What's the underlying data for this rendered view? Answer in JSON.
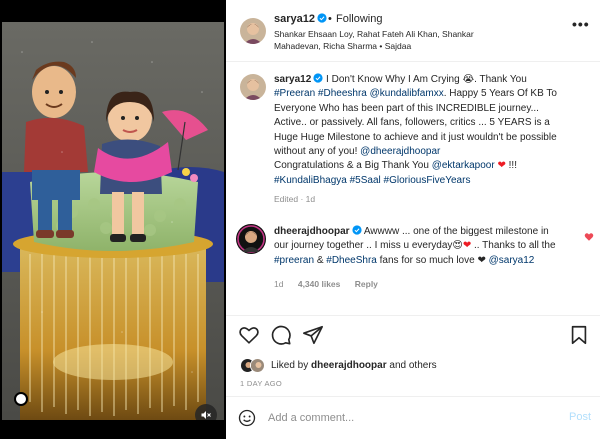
{
  "post": {
    "author": "sarya12",
    "follow_label": "Following",
    "separator": "•",
    "audio": "Shankar Ehsaan Loy, Rahat Fateh Ali Khan, Shankar Mahadevan, Richa Sharma • Sajdaa",
    "more_label": "•••"
  },
  "caption": {
    "author": "sarya12",
    "text_1": "I Don't Know Why I Am Crying 😭. Thank You",
    "tag_preeran": "#Preeran",
    "tag_dheeshra": "#Dheeshra",
    "tag_kundalibfamxx": "@kundalibfamxx",
    "text_2": ". Happy 5 Years Of KB To Everyone Who has been part of this INCREDIBLE journey... Active.. or passively. All fans, followers, critics ... 5 YEARS is a Huge Huge Milestone to achieve and it just wouldn't be possible without any of you!",
    "tag_dheerajdhoopar": "@dheerajdhoopar",
    "text_3": "Congratulations & a Big Thank You",
    "tag_ektarkapoor": "@ektarkapoor",
    "heart": "❤",
    "text_4": "!!!",
    "tag_kundalibhagya": "#KundaliBhagya",
    "tag_5saal": "#5Saal",
    "tag_gloriousfiveyears": "#GloriousFiveYears",
    "meta": "Edited · 1d"
  },
  "reply": {
    "author": "dheerajdhoopar",
    "text_1": "Awwww ... one of the biggest milestone in our journey together .. I miss u everyday",
    "emoji": "😍",
    "heart": "❤",
    "text_2": ".. Thanks to all the",
    "tag_preeran": "#preeran",
    "amp": "&",
    "tag_dheeshra": "#DheeShra",
    "text_3": "fans for so much love ❤",
    "tag_sarya12": "@sarya12",
    "time": "1d",
    "likes": "4,340 likes",
    "reply_label": "Reply"
  },
  "actions": {
    "liked_by_prefix": "Liked by",
    "liked_by_user": "dheerajdhoopar",
    "liked_by_suffix": "and others",
    "time_ago": "1 DAY AGO"
  },
  "comment_box": {
    "placeholder": "Add a comment...",
    "post_label": "Post"
  },
  "colors": {
    "link": "#00376b",
    "verified": "#0095f6",
    "like_heart": "#ed4956",
    "post_disabled": "#b2dffc"
  },
  "icons": [
    "verified-badge-icon",
    "more-options-icon",
    "heart-icon",
    "comment-icon",
    "share-icon",
    "save-icon",
    "emoji-icon",
    "mute-icon"
  ]
}
